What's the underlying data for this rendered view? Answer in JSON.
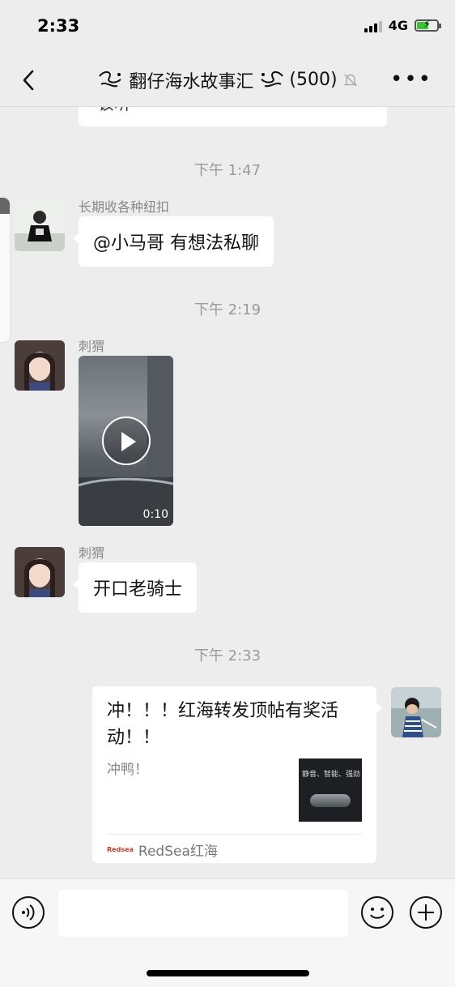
{
  "status_bar": {
    "time": "2:33",
    "network": "4G"
  },
  "nav": {
    "title": "翻仔海水故事汇",
    "count": "(500)"
  },
  "messages": [
    {
      "partial_text": "该听"
    },
    {
      "time": "下午 1:47"
    },
    {
      "sender": "长期收各种纽扣",
      "text": "@小马哥 有想法私聊"
    },
    {
      "time": "下午 2:19"
    },
    {
      "sender": "刺猬",
      "video_duration": "0:10"
    },
    {
      "sender": "刺猬",
      "text": "开口老骑士"
    },
    {
      "time": "下午 2:33"
    },
    {
      "card_title": "冲！！！红海转发顶帖有奖活动！！",
      "card_desc": "冲鸭！",
      "card_thumb_text": "静音、智能、强劲",
      "card_source_logo": "Redsea",
      "card_source": "RedSea红海"
    }
  ],
  "icons": {
    "back": "back-chevron-icon",
    "mute": "bell-muted-icon",
    "more": "more-dots-icon",
    "voice": "voice-icon",
    "emoji": "emoji-icon",
    "plus": "plus-icon"
  },
  "colors": {
    "background": "#ededed",
    "bubble": "#ffffff",
    "time_label": "#9a9a9a",
    "battery": "#3fc23a"
  }
}
